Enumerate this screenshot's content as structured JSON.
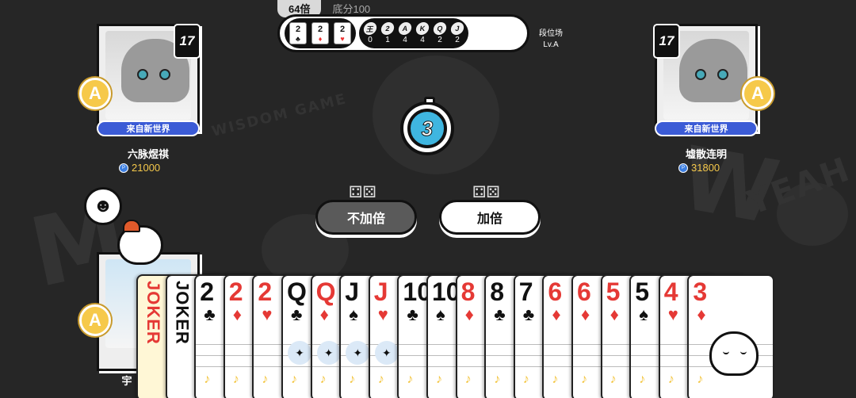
{
  "header": {
    "multiplier": "64倍",
    "base_score": "底分100",
    "hole_cards": [
      {
        "rank": "2",
        "suit": "♣",
        "color": "black"
      },
      {
        "rank": "2",
        "suit": "♦",
        "color": "red"
      },
      {
        "rank": "2",
        "suit": "♥",
        "color": "red"
      }
    ],
    "tracker": [
      {
        "rank": "王",
        "count": "0"
      },
      {
        "rank": "2",
        "count": "1"
      },
      {
        "rank": "A",
        "count": "4"
      },
      {
        "rank": "K",
        "count": "4"
      },
      {
        "rank": "Q",
        "count": "2"
      },
      {
        "rank": "J",
        "count": "2"
      }
    ],
    "rank_label": "段位场",
    "rank_level": "Lv.A"
  },
  "players": {
    "left": {
      "level": "17",
      "badge": "A",
      "title": "来自新世界",
      "name": "六脉煜祺",
      "score": "21000"
    },
    "right": {
      "level": "17",
      "badge": "A",
      "title": "来自新世界",
      "name": "墟散连明",
      "score": "31800"
    },
    "self": {
      "badge": "A",
      "name": "宇"
    }
  },
  "timer": {
    "seconds": "3"
  },
  "actions": {
    "no_double": "不加倍",
    "double": "加倍"
  },
  "hand": [
    {
      "rank": "JOKER",
      "suit": "",
      "color": "red",
      "type": "joker"
    },
    {
      "rank": "JOKER",
      "suit": "",
      "color": "black",
      "type": "joker"
    },
    {
      "rank": "2",
      "suit": "♣",
      "color": "black"
    },
    {
      "rank": "2",
      "suit": "♦",
      "color": "red"
    },
    {
      "rank": "2",
      "suit": "♥",
      "color": "red"
    },
    {
      "rank": "Q",
      "suit": "♣",
      "color": "black"
    },
    {
      "rank": "Q",
      "suit": "♦",
      "color": "red"
    },
    {
      "rank": "J",
      "suit": "♠",
      "color": "black"
    },
    {
      "rank": "J",
      "suit": "♥",
      "color": "red"
    },
    {
      "rank": "10",
      "suit": "♣",
      "color": "black"
    },
    {
      "rank": "10",
      "suit": "♠",
      "color": "black"
    },
    {
      "rank": "8",
      "suit": "♦",
      "color": "red"
    },
    {
      "rank": "8",
      "suit": "♣",
      "color": "black"
    },
    {
      "rank": "7",
      "suit": "♣",
      "color": "black"
    },
    {
      "rank": "6",
      "suit": "♦",
      "color": "red"
    },
    {
      "rank": "6",
      "suit": "♦",
      "color": "red"
    },
    {
      "rank": "5",
      "suit": "♦",
      "color": "red"
    },
    {
      "rank": "5",
      "suit": "♠",
      "color": "black"
    },
    {
      "rank": "4",
      "suit": "♥",
      "color": "red"
    },
    {
      "rank": "3",
      "suit": "♦",
      "color": "red"
    }
  ],
  "background": {
    "watermark": [
      "WISDOM GAME",
      "YEAH"
    ]
  },
  "colors": {
    "accent_blue": "#3fb6e0",
    "title_blue": "#3b5bd6",
    "gold": "#f4c84b",
    "red_suit": "#e53935"
  }
}
